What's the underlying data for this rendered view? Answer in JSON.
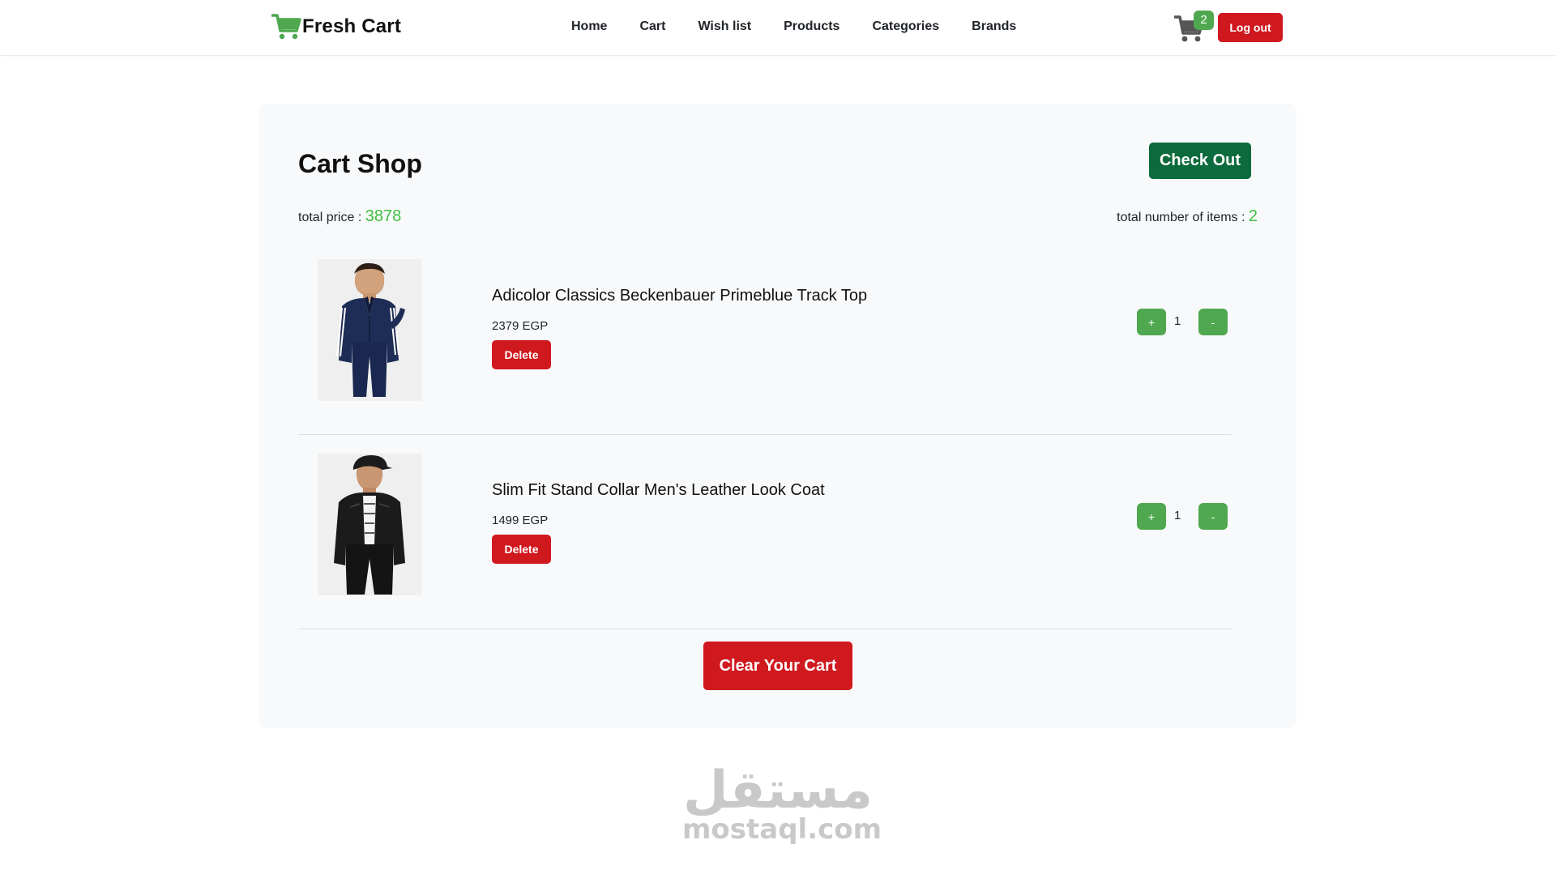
{
  "navbar": {
    "brand": "Fresh Cart",
    "links": [
      "Home",
      "Cart",
      "Wish list",
      "Products",
      "Categories",
      "Brands"
    ],
    "cart_count": "2",
    "logout_label": "Log out"
  },
  "cart": {
    "title": "Cart Shop",
    "checkout_label": "Check Out",
    "total_price_label": "total price : ",
    "total_price": "3878",
    "total_items_label": "total number of items : ",
    "total_items": "2",
    "items": [
      {
        "title": "Adicolor Classics Beckenbauer Primeblue Track Top",
        "price": "2379 EGP",
        "delete_label": "Delete",
        "plus_label": "+",
        "minus_label": "-",
        "quantity": "1"
      },
      {
        "title": "Slim Fit Stand Collar Men's Leather Look Coat",
        "price": "1499 EGP",
        "delete_label": "Delete",
        "plus_label": "+",
        "minus_label": "-",
        "quantity": "1"
      }
    ],
    "clear_label": "Clear Your Cart"
  },
  "watermark": {
    "arabic": "مستقل",
    "latin": "mostaql.com"
  },
  "colors": {
    "brand_green": "#4fa84f",
    "checkout_green": "#0c6b3c",
    "danger_red": "#d0181f",
    "value_green": "#3fbf3f",
    "panel_bg": "#f8f9fa"
  },
  "icons": [
    "cart-icon",
    "nav-cart-icon"
  ]
}
